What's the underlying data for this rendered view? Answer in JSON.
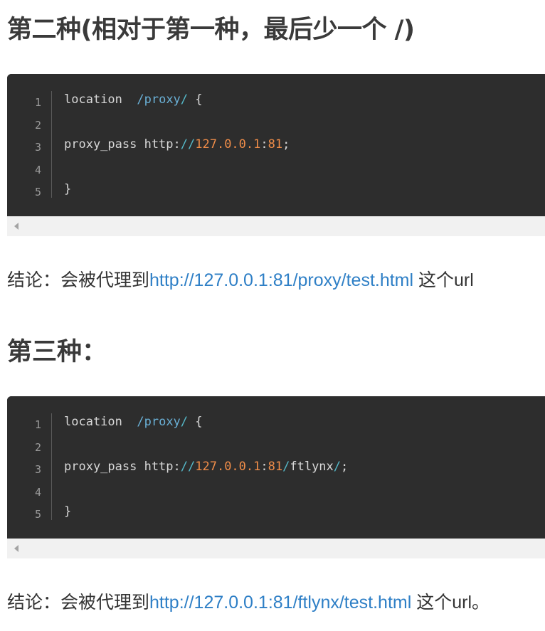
{
  "heading1": "第二种(相对于第一种，最后少一个 /)",
  "code1": {
    "line_numbers": [
      "1",
      "2",
      "3",
      "4",
      "5"
    ],
    "line1": {
      "keyword": "location",
      "path": "/proxy",
      "slash": "/",
      "brace": " {"
    },
    "line3": {
      "directive": "proxy_pass http:",
      "sep": "//",
      "ip": "127.0.0.1",
      "colon": ":",
      "port": "81",
      "end": ";"
    },
    "line5": "}"
  },
  "conclusion1": {
    "prefix": "结论：会被代理到",
    "url": "http://127.0.0.1:81/proxy/test.html",
    "suffix": " 这个url"
  },
  "heading2": "第三种：",
  "code2": {
    "line_numbers": [
      "1",
      "2",
      "3",
      "4",
      "5"
    ],
    "line1": {
      "keyword": "location",
      "path": "/proxy",
      "slash": "/",
      "brace": " {"
    },
    "line3": {
      "directive": "proxy_pass http:",
      "sep": "//",
      "ip": "127.0.0.1",
      "colon": ":",
      "port": "81",
      "slash1": "/",
      "path": "ftlynx",
      "slash2": "/",
      "end": ";"
    },
    "line5": "}"
  },
  "conclusion2": {
    "prefix": "结论：会被代理到",
    "url": "http://127.0.0.1:81/ftlynx/test.html",
    "suffix": " 这个url。"
  },
  "colors": {
    "code_bg": "#2d2d2d",
    "number_orange": "#f08d49",
    "path_blue": "#6ab0d6",
    "link_blue": "#2e7fc6"
  }
}
